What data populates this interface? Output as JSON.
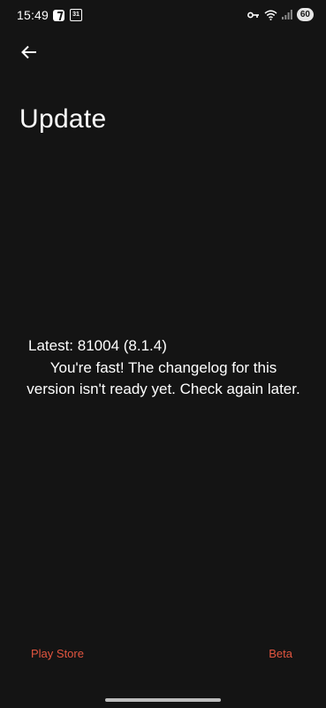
{
  "status_bar": {
    "time": "15:49",
    "calendar_day": "31",
    "battery": "60",
    "icons": [
      "app-notification-icon",
      "calendar-icon",
      "key-icon",
      "wifi-icon",
      "signal-icon",
      "battery-icon"
    ]
  },
  "header": {
    "back_icon": "arrow-left-icon",
    "title": "Update"
  },
  "content": {
    "version_heading": "Latest: 81004 (8.1.4)",
    "changelog_message": "You're fast! The changelog for this version isn't ready yet. Check again later."
  },
  "actions": {
    "play_store_label": "Play Store",
    "beta_label": "Beta",
    "accent_color": "#e2553f"
  },
  "theme": {
    "background": "#141414",
    "text": "#ffffff"
  }
}
